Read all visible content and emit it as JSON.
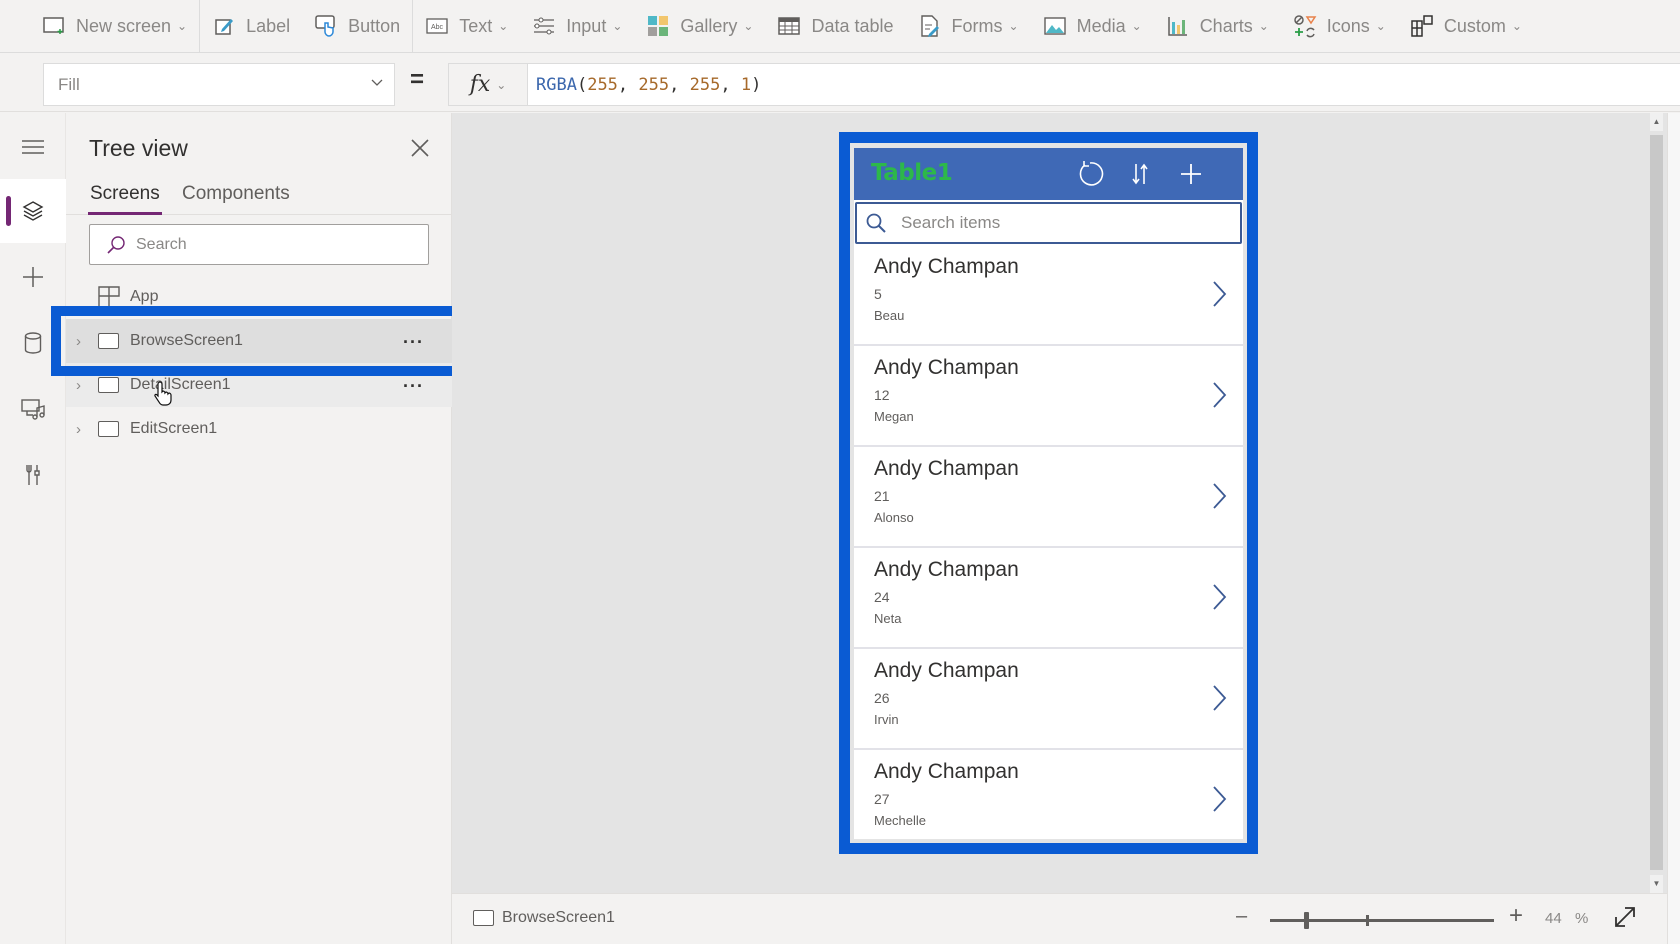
{
  "ribbon": {
    "items": [
      {
        "label": "New screen",
        "icon": "new-screen-icon",
        "dropdown": true
      },
      {
        "label": "Label",
        "icon": "label-icon",
        "dropdown": false
      },
      {
        "label": "Button",
        "icon": "button-icon",
        "dropdown": false
      },
      {
        "label": "Text",
        "icon": "text-icon",
        "dropdown": true
      },
      {
        "label": "Input",
        "icon": "input-icon",
        "dropdown": true
      },
      {
        "label": "Gallery",
        "icon": "gallery-icon",
        "dropdown": true
      },
      {
        "label": "Data table",
        "icon": "data-table-icon",
        "dropdown": false
      },
      {
        "label": "Forms",
        "icon": "forms-icon",
        "dropdown": true
      },
      {
        "label": "Media",
        "icon": "media-icon",
        "dropdown": true
      },
      {
        "label": "Charts",
        "icon": "charts-icon",
        "dropdown": true
      },
      {
        "label": "Icons",
        "icon": "icons-icon",
        "dropdown": true
      },
      {
        "label": "Custom",
        "icon": "custom-icon",
        "dropdown": true
      }
    ],
    "text_icon_glyph": "Abc"
  },
  "formula_bar": {
    "property": "Fill",
    "equals": "=",
    "fx_label": "fx",
    "formula": {
      "fn": "RGBA",
      "open": "(",
      "args": [
        "255",
        "255",
        "255",
        "1"
      ],
      "sep": ", ",
      "close": ")"
    }
  },
  "rail": {
    "items": [
      {
        "name": "hamburger-menu",
        "active": false
      },
      {
        "name": "tree-view",
        "active": true
      },
      {
        "name": "insert",
        "active": false
      },
      {
        "name": "data",
        "active": false
      },
      {
        "name": "media",
        "active": false
      },
      {
        "name": "advanced-tools",
        "active": false
      }
    ]
  },
  "tree_view": {
    "title": "Tree view",
    "tabs": [
      {
        "label": "Screens",
        "active": true
      },
      {
        "label": "Components",
        "active": false
      }
    ],
    "search_placeholder": "Search",
    "app_node": "App",
    "screens": [
      {
        "label": "BrowseScreen1",
        "selected": true,
        "more": "..."
      },
      {
        "label": "DetailScreen1",
        "selected": false,
        "hovered": true,
        "more": "..."
      },
      {
        "label": "EditScreen1",
        "selected": false
      }
    ]
  },
  "preview": {
    "title": "Table1",
    "search_placeholder": "Search items",
    "items": [
      {
        "title": "Andy Champan",
        "subtitle": "5",
        "body": "Beau"
      },
      {
        "title": "Andy Champan",
        "subtitle": "12",
        "body": "Megan"
      },
      {
        "title": "Andy Champan",
        "subtitle": "21",
        "body": "Alonso"
      },
      {
        "title": "Andy Champan",
        "subtitle": "24",
        "body": "Neta"
      },
      {
        "title": "Andy Champan",
        "subtitle": "26",
        "body": "Irvin"
      },
      {
        "title": "Andy Champan",
        "subtitle": "27",
        "body": "Mechelle"
      }
    ]
  },
  "status_bar": {
    "screen_name": "BrowseScreen1",
    "zoom_value": "44",
    "zoom_unit": "%",
    "zoom_percent": 44
  },
  "colors": {
    "highlight": "#0a5bd3",
    "accent": "#742774",
    "app_header": "#3f69b6",
    "app_title": "#2db84a"
  }
}
